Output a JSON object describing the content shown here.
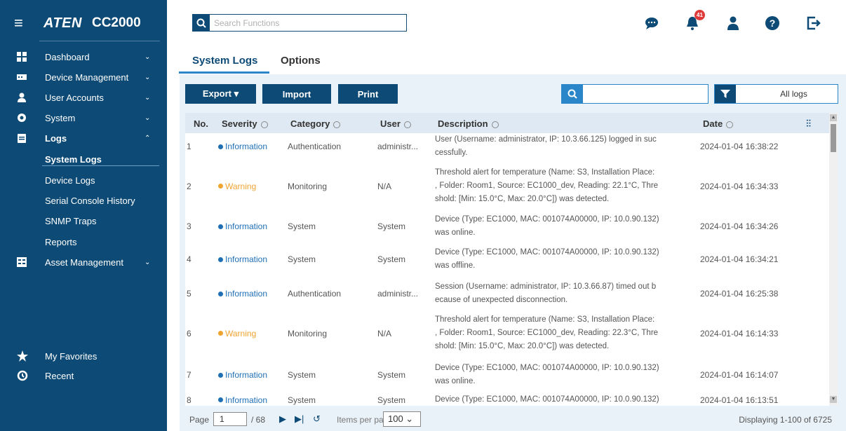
{
  "app": {
    "logo": "ATEN",
    "model": "CC2000",
    "menu_icon": "hamburger-icon"
  },
  "header": {
    "search_placeholder": "Search Functions",
    "notification_count": "41",
    "icons": [
      "chat-icon",
      "bell-icon",
      "user-icon",
      "help-icon",
      "logout-icon"
    ]
  },
  "sidebar": {
    "items": [
      {
        "label": "Dashboard",
        "icon": "dashboard-icon",
        "chevron": "⌄"
      },
      {
        "label": "Device Management",
        "icon": "device-icon",
        "chevron": "⌄"
      },
      {
        "label": "User Accounts",
        "icon": "user-accounts-icon",
        "chevron": "⌄"
      },
      {
        "label": "System",
        "icon": "gear-icon",
        "chevron": "⌄"
      },
      {
        "label": "Logs",
        "icon": "clipboard-icon",
        "chevron": "⌃"
      },
      {
        "label": "Asset Management",
        "icon": "asset-icon",
        "chevron": "⌄"
      }
    ],
    "log_subitems": [
      "System Logs",
      "Device Logs",
      "Serial Console History",
      "SNMP Traps",
      "Reports"
    ],
    "bottom": [
      {
        "label": "My Favorites",
        "icon": "star-icon"
      },
      {
        "label": "Recent",
        "icon": "history-icon"
      }
    ]
  },
  "tabs": [
    {
      "label": "System Logs",
      "active": true
    },
    {
      "label": "Options",
      "active": false
    }
  ],
  "toolbar": {
    "export_label": "Export ▾",
    "import_label": "Import",
    "print_label": "Print",
    "search_value": "",
    "filter_value": "All logs"
  },
  "table": {
    "columns": [
      "No.",
      "Severity",
      "Category",
      "User",
      "Description",
      "Date"
    ],
    "rows": [
      {
        "no": "1",
        "severity": "Information",
        "category": "Authentication",
        "user": "administr...",
        "desc": [
          "User (Username: administrator, IP: 10.3.66.125) logged in suc",
          "cessfully."
        ],
        "date": "2024-01-04 16:38:22"
      },
      {
        "no": "2",
        "severity": "Warning",
        "category": "Monitoring",
        "user": "N/A",
        "desc": [
          "Threshold alert for temperature (Name: S3, Installation Place:",
          ", Folder: Room1, Source: EC1000_dev, Reading: 22.1°C, Thre",
          "shold: [Min: 15.0°C, Max: 20.0°C]) was detected."
        ],
        "date": "2024-01-04 16:34:33"
      },
      {
        "no": "3",
        "severity": "Information",
        "category": "System",
        "user": "System",
        "desc": [
          "Device (Type: EC1000, MAC: 001074A00000, IP: 10.0.90.132)",
          "was online."
        ],
        "date": "2024-01-04 16:34:26"
      },
      {
        "no": "4",
        "severity": "Information",
        "category": "System",
        "user": "System",
        "desc": [
          "Device (Type: EC1000, MAC: 001074A00000, IP: 10.0.90.132)",
          "was offline."
        ],
        "date": "2024-01-04 16:34:21"
      },
      {
        "no": "5",
        "severity": "Information",
        "category": "Authentication",
        "user": "administr...",
        "desc": [
          "Session (Username: administrator, IP: 10.3.66.87) timed out b",
          "ecause of unexpected disconnection."
        ],
        "date": "2024-01-04 16:25:38"
      },
      {
        "no": "6",
        "severity": "Warning",
        "category": "Monitoring",
        "user": "N/A",
        "desc": [
          "Threshold alert for temperature (Name: S3, Installation Place:",
          ", Folder: Room1, Source: EC1000_dev, Reading: 22.3°C, Thre",
          "shold: [Min: 15.0°C, Max: 20.0°C]) was detected."
        ],
        "date": "2024-01-04 16:14:33"
      },
      {
        "no": "7",
        "severity": "Information",
        "category": "System",
        "user": "System",
        "desc": [
          "Device (Type: EC1000, MAC: 001074A00000, IP: 10.0.90.132)",
          "was online."
        ],
        "date": "2024-01-04 16:14:07"
      },
      {
        "no": "8",
        "severity": "Information",
        "category": "System",
        "user": "System",
        "desc": [
          "Device (Type: EC1000, MAC: 001074A00000, IP: 10.0.90.132)"
        ],
        "date": "2024-01-04 16:13:51"
      }
    ]
  },
  "pager": {
    "page_label": "Page",
    "page_value": "1",
    "total": "/ 68",
    "items_label": "Items per page",
    "items_value": "100 ⌄",
    "display": "Displaying 1-100 of 6725"
  },
  "colors": {
    "sidebar": "#0d4a75",
    "accent": "#2a86c8",
    "info": "#1f6fb5",
    "warning": "#f0a430"
  }
}
